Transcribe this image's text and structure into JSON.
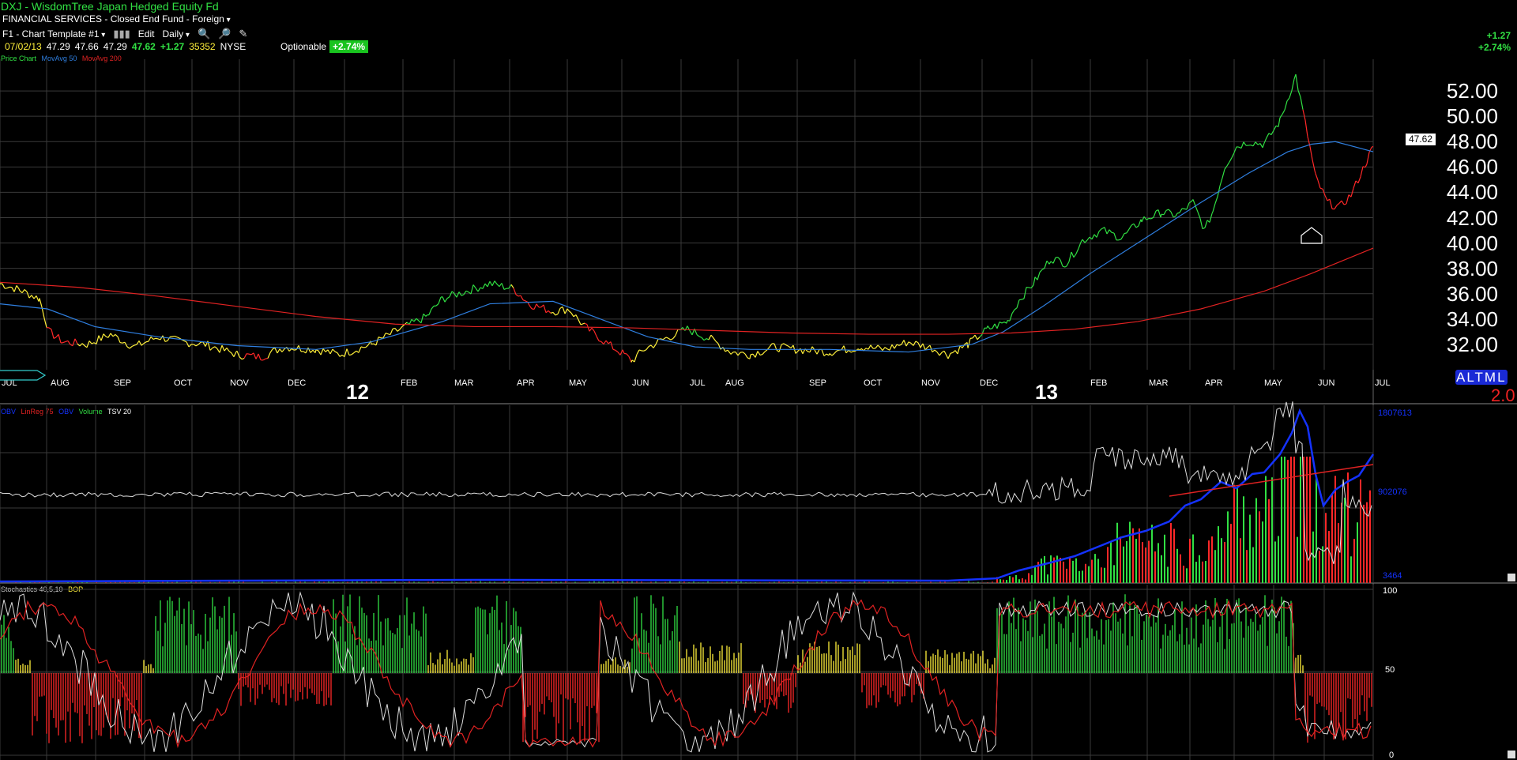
{
  "header": {
    "title": "DXJ - WisdomTree Japan Hedged Equity Fd",
    "subtitle_sector": "FINANCIAL SERVICES",
    "subtitle_type": "Closed End Fund",
    "subtitle_region": "Foreign",
    "template": "F1 - Chart Template #1",
    "toolbar_edit": "Edit",
    "toolbar_period": "Daily",
    "quote_date": "07/02/13",
    "quote_open": "47.29",
    "quote_high": "47.66",
    "quote_low": "47.29",
    "quote_close": "47.62",
    "quote_change": "+1.27",
    "quote_volume": "35352",
    "quote_exchange": "NYSE",
    "optionable": "Optionable",
    "pct_badge": "+2.74%",
    "right_change": "+1.27",
    "right_pct": "+2.74%"
  },
  "legend_price": {
    "a": "Price Chart",
    "b": "MovAvg 50",
    "c": "MovAvg 200"
  },
  "legend_vol": {
    "a": "OBV",
    "b": "LinReg 75",
    "c": "OBV",
    "d": "Volume",
    "e": "TSV 20"
  },
  "legend_stoch": {
    "a": "Stochastics 40,5,10",
    "b": "BOP"
  },
  "price_axis": [
    "52.00",
    "50.00",
    "48.00",
    "46.00",
    "44.00",
    "42.00",
    "40.00",
    "38.00",
    "36.00",
    "34.00",
    "32.00"
  ],
  "current_price_box": "47.62",
  "months": [
    "JUL",
    "AUG",
    "SEP",
    "OCT",
    "NOV",
    "DEC",
    "FEB",
    "MAR",
    "APR",
    "MAY",
    "JUN",
    "JUL",
    "AUG",
    "SEP",
    "OCT",
    "NOV",
    "DEC",
    "FEB",
    "MAR",
    "APR",
    "MAY",
    "JUN",
    "JUL"
  ],
  "year_labels": [
    "12",
    "13"
  ],
  "vol_axis": {
    "top": "1807613",
    "mid": "902076",
    "bottom": "3464"
  },
  "stoch_axis": {
    "top": "100",
    "mid": "50",
    "bottom": "0"
  },
  "altml": {
    "letters": "ALTML",
    "value": "2.0"
  },
  "colors": {
    "up": "#31e043",
    "flat": "#fff03a",
    "down": "#ff2828",
    "ma50": "#2f7fe0",
    "ma200": "#e02222",
    "obv": "#1432ff",
    "grid": "#3a3a3a"
  },
  "chart_data": {
    "type": "line",
    "title": "DXJ - WisdomTree Japan Hedged Equity Fd",
    "x_range": [
      "JUL 2012",
      "JUL 2013"
    ],
    "ylim": [
      30,
      53
    ],
    "series": [
      {
        "name": "Price Chart",
        "values": [
          {
            "x": "JUL",
            "y": 36.8
          },
          {
            "x": "AUG",
            "y": 32.0
          },
          {
            "x": "SEP",
            "y": 32.5
          },
          {
            "x": "OCT",
            "y": 32.3
          },
          {
            "x": "NOV",
            "y": 31.0
          },
          {
            "x": "DEC",
            "y": 31.8
          },
          {
            "x": "FEB",
            "y": 33.5
          },
          {
            "x": "MAR",
            "y": 36.5
          },
          {
            "x": "APR",
            "y": 35.0
          },
          {
            "x": "MAY",
            "y": 33.0
          },
          {
            "x": "JUN",
            "y": 31.0
          },
          {
            "x": "JUL",
            "y": 33.0
          },
          {
            "x": "AUG",
            "y": 31.5
          },
          {
            "x": "SEP",
            "y": 31.5
          },
          {
            "x": "OCT",
            "y": 31.5
          },
          {
            "x": "NOV",
            "y": 31.0
          },
          {
            "x": "DEC",
            "y": 34.5
          },
          {
            "x": "FEB",
            "y": 39.0
          },
          {
            "x": "MAR",
            "y": 40.5
          },
          {
            "x": "APR",
            "y": 44.5
          },
          {
            "x": "MAY",
            "y": 52.5
          },
          {
            "x": "JUN",
            "y": 43.5
          },
          {
            "x": "JUL",
            "y": 47.62
          }
        ]
      },
      {
        "name": "MovAvg 50",
        "values": [
          {
            "x": "JUL",
            "y": 35.2
          },
          {
            "x": "SEP",
            "y": 32.8
          },
          {
            "x": "NOV",
            "y": 31.6
          },
          {
            "x": "MAR",
            "y": 34.0
          },
          {
            "x": "APR",
            "y": 35.5
          },
          {
            "x": "JUN",
            "y": 33.2
          },
          {
            "x": "AUG",
            "y": 31.5
          },
          {
            "x": "NOV",
            "y": 31.4
          },
          {
            "x": "DEC",
            "y": 32.2
          },
          {
            "x": "MAR",
            "y": 38.0
          },
          {
            "x": "MAY",
            "y": 44.0
          },
          {
            "x": "JUN",
            "y": 47.5
          },
          {
            "x": "JUL",
            "y": 47.2
          }
        ]
      },
      {
        "name": "MovAvg 200",
        "values": [
          {
            "x": "JUL",
            "y": 36.8
          },
          {
            "x": "OCT",
            "y": 34.8
          },
          {
            "x": "DEC",
            "y": 33.4
          },
          {
            "x": "MAR",
            "y": 33.2
          },
          {
            "x": "NOV",
            "y": 32.6
          },
          {
            "x": "FEB",
            "y": 33.0
          },
          {
            "x": "APR",
            "y": 34.0
          },
          {
            "x": "JUN",
            "y": 37.5
          },
          {
            "x": "JUL",
            "y": 39.6
          }
        ]
      }
    ]
  }
}
